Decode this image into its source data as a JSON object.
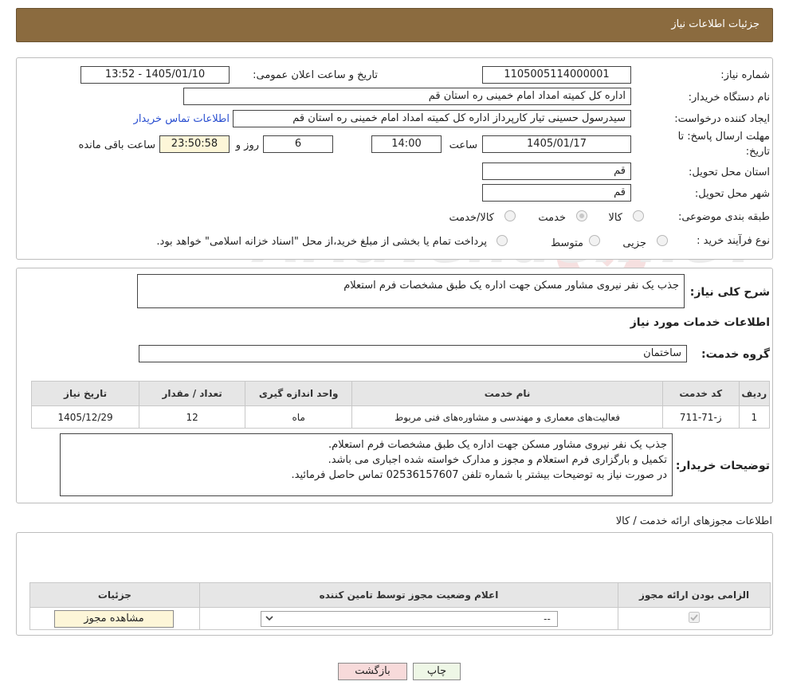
{
  "header": {
    "title": "جزئیات اطلاعات نیاز"
  },
  "need": {
    "number_label": "شماره نیاز:",
    "number": "1105005114000001",
    "announce_label": "تاریخ و ساعت اعلان عمومی:",
    "announce": "1405/01/10 - 13:52",
    "buyer_label": "نام دستگاه خریدار:",
    "buyer": "اداره کل کمیته امداد امام خمینی  ره  استان قم",
    "creator_label": "ایجاد کننده درخواست:",
    "creator": "سیدرسول حسینی تیار کارپرداز اداره کل کمیته امداد امام خمینی  ره  استان قم",
    "contact_link": "اطلاعات تماس خریدار",
    "deadline_label_1": "مهلت ارسال پاسخ: تا",
    "deadline_label_2": "تاریخ:",
    "deadline_date": "1405/01/17",
    "time_label": "ساعت",
    "deadline_time": "14:00",
    "days": "6",
    "days_label": "روز و",
    "remaining": "23:50:58",
    "remaining_label": "ساعت باقی مانده",
    "province_label": "استان محل تحویل:",
    "province": "قم",
    "city_label": "شهر محل تحویل:",
    "city": "قم",
    "category_label": "طبقه بندی موضوعی:",
    "category_options": [
      "کالا",
      "خدمت",
      "کالا/خدمت"
    ],
    "process_label": "نوع فرآیند خرید :",
    "process_options": [
      "جزیی",
      "متوسط"
    ],
    "process_note": "پرداخت تمام یا بخشی از مبلغ خرید،از محل \"اسناد خزانه اسلامی\" خواهد بود."
  },
  "summary": {
    "label": "شرح کلی نیاز:",
    "text": "جذب یک نفر نیروی مشاور مسکن جهت اداره یک طبق مشخصات فرم استعلام",
    "services_title": "اطلاعات خدمات مورد نیاز",
    "group_label": "گروه خدمت:",
    "group": "ساختمان"
  },
  "services_table": {
    "headers": [
      "ردیف",
      "کد خدمت",
      "نام خدمت",
      "واحد اندازه گیری",
      "تعداد / مقدار",
      "تاریخ نیاز"
    ],
    "rows": [
      [
        "1",
        "ز-71-711",
        "فعالیت‌های معماری و مهندسی و مشاوره‌های فنی مربوط",
        "ماه",
        "12",
        "1405/12/29"
      ]
    ]
  },
  "buyer_notes": {
    "label": "توضیحات خریدار:",
    "text": "جذب یک نفر نیروی مشاور مسکن جهت اداره یک طبق مشخصات فرم استعلام.\nتکمیل و بارگزاری فرم استعلام و مجوز و مدارک خواسته شده اجباری می باشد.\nدر صورت نیاز به توضیحات بیشتر با شماره تلفن 02536157607 تماس حاصل فرمائید."
  },
  "permits": {
    "title": "اطلاعات مجوزهای ارائه خدمت / کالا",
    "headers": [
      "الزامی بودن ارائه مجوز",
      "اعلام وضعیت مجوز توسط تامین کننده",
      "جزئیات"
    ],
    "select_value": "--",
    "view_button": "مشاهده مجوز"
  },
  "watermark": "AriaTender.neT",
  "buttons": {
    "print": "چاپ",
    "back": "بازگشت"
  },
  "colors": {
    "header_bg": "#8b6b3f",
    "link": "#2a4fd0",
    "time_bg": "#fdf6d8",
    "back_btn_bg": "#f7dada",
    "print_btn_bg": "#eef7e6"
  }
}
